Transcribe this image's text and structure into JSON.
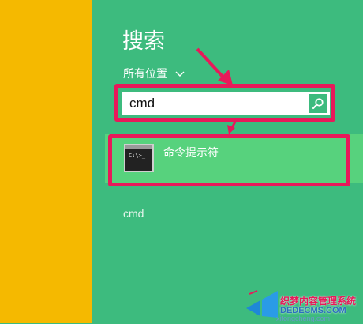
{
  "search_pane": {
    "title": "搜索",
    "scope_label": "所有位置",
    "search_value": "cmd",
    "result": {
      "label": "命令提示符",
      "icon": "cmd-console-icon",
      "icon_text": "C:\\>_"
    },
    "suggestion": "cmd"
  },
  "watermark": {
    "line1": "织梦内容管理系统",
    "line2": "DEDECMS.COM",
    "line3": "xitongcheng.com"
  },
  "colors": {
    "panel_green": "#3dbb7e",
    "result_highlight": "#57d27d",
    "left_strip": "#f5b900",
    "annotation": "#e8195a"
  }
}
